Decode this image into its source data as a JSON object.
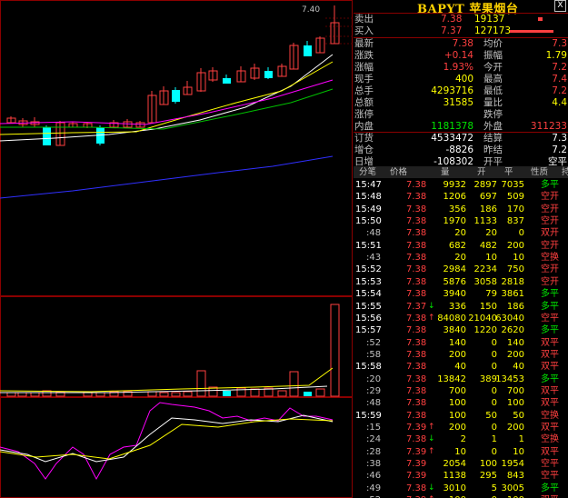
{
  "header": {
    "name": "BAPYT 苹果烟台",
    "close_label": "X"
  },
  "chart": {
    "high_price_label": "7.40"
  },
  "quote": {
    "sell": {
      "label": "卖出",
      "price": "7.38",
      "vol": "19137"
    },
    "buy": {
      "label": "买入",
      "price": "7.37",
      "vol": "127173"
    },
    "rows": [
      {
        "l1": "最新",
        "v1": "7.38",
        "l2": "均价",
        "v2": "7.3"
      },
      {
        "l1": "涨跌",
        "v1": "+0.14",
        "l2": "振幅",
        "v2": "1.79"
      },
      {
        "l1": "涨幅",
        "v1": "1.93%",
        "l2": "今开",
        "v2": "7.2"
      },
      {
        "l1": "现手",
        "v1": "400",
        "l2": "最高",
        "v2": "7.4"
      },
      {
        "l1": "总手",
        "v1": "4293716",
        "l2": "最低",
        "v2": "7.2"
      },
      {
        "l1": "总额",
        "v1": "31585",
        "l2": "量比",
        "v2": "4.4"
      },
      {
        "l1": "涨停",
        "v1": "",
        "l2": "跌停",
        "v2": ""
      },
      {
        "l1": "内盘",
        "v1": "1181378",
        "l2": "外盘",
        "v2": "311233"
      }
    ],
    "rows2": [
      {
        "l1": "订货",
        "v1": "4533472",
        "l2": "结算",
        "v2": "7.3"
      },
      {
        "l1": "增仓",
        "v1": "-8826",
        "l2": "昨结",
        "v2": "7.2"
      },
      {
        "l1": "日增",
        "v1": "-108302",
        "l2": "开平",
        "v2": "空平"
      }
    ]
  },
  "ticks": {
    "headers": [
      "分笔",
      "价格",
      "量",
      "开",
      "平",
      "性质",
      "持"
    ],
    "rows": [
      {
        "t": "15:47",
        "p": "7.38",
        "a": "",
        "q": "9932",
        "o": "2897",
        "c": "7035",
        "n": "多平"
      },
      {
        "t": "15:48",
        "p": "7.38",
        "a": "",
        "q": "1206",
        "o": "697",
        "c": "509",
        "n": "空开"
      },
      {
        "t": "15:49",
        "p": "7.38",
        "a": "",
        "q": "356",
        "o": "186",
        "c": "170",
        "n": "空开"
      },
      {
        "t": "15:50",
        "p": "7.38",
        "a": "",
        "q": "1970",
        "o": "1133",
        "c": "837",
        "n": "空开"
      },
      {
        "t": ":48",
        "p": "7.38",
        "a": "",
        "q": "20",
        "o": "20",
        "c": "0",
        "n": "双开"
      },
      {
        "t": "15:51",
        "p": "7.38",
        "a": "",
        "q": "682",
        "o": "482",
        "c": "200",
        "n": "空开"
      },
      {
        "t": ":43",
        "p": "7.38",
        "a": "",
        "q": "20",
        "o": "10",
        "c": "10",
        "n": "空换"
      },
      {
        "t": "15:52",
        "p": "7.38",
        "a": "",
        "q": "2984",
        "o": "2234",
        "c": "750",
        "n": "空开"
      },
      {
        "t": "15:53",
        "p": "7.38",
        "a": "",
        "q": "5876",
        "o": "3058",
        "c": "2818",
        "n": "空开"
      },
      {
        "t": "15:54",
        "p": "7.38",
        "a": "",
        "q": "3940",
        "o": "79",
        "c": "3861",
        "n": "多平"
      },
      {
        "t": "15:55",
        "p": "7.37",
        "a": "↓",
        "q": "336",
        "o": "150",
        "c": "186",
        "n": "多平"
      },
      {
        "t": "15:56",
        "p": "7.38",
        "a": "↑",
        "q": "84080",
        "o": "21040",
        "c": "63040",
        "n": "空平"
      },
      {
        "t": "15:57",
        "p": "7.38",
        "a": "",
        "q": "3840",
        "o": "1220",
        "c": "2620",
        "n": "多平"
      },
      {
        "t": ":52",
        "p": "7.38",
        "a": "",
        "q": "140",
        "o": "0",
        "c": "140",
        "n": "双平"
      },
      {
        "t": ":58",
        "p": "7.38",
        "a": "",
        "q": "200",
        "o": "0",
        "c": "200",
        "n": "双平"
      },
      {
        "t": "15:58",
        "p": "7.38",
        "a": "",
        "q": "40",
        "o": "0",
        "c": "40",
        "n": "双平"
      },
      {
        "t": ":20",
        "p": "7.38",
        "a": "",
        "q": "13842",
        "o": "389",
        "c": "13453",
        "n": "多平"
      },
      {
        "t": ":29",
        "p": "7.38",
        "a": "",
        "q": "700",
        "o": "0",
        "c": "700",
        "n": "双平"
      },
      {
        "t": ":48",
        "p": "7.38",
        "a": "",
        "q": "100",
        "o": "0",
        "c": "100",
        "n": "双平"
      },
      {
        "t": "15:59",
        "p": "7.38",
        "a": "",
        "q": "100",
        "o": "50",
        "c": "50",
        "n": "空换"
      },
      {
        "t": ":15",
        "p": "7.39",
        "a": "↑",
        "q": "200",
        "o": "0",
        "c": "200",
        "n": "双平"
      },
      {
        "t": ":24",
        "p": "7.38",
        "a": "↓",
        "q": "2",
        "o": "1",
        "c": "1",
        "n": "空换"
      },
      {
        "t": ":28",
        "p": "7.39",
        "a": "↑",
        "q": "10",
        "o": "0",
        "c": "10",
        "n": "双平"
      },
      {
        "t": ":38",
        "p": "7.39",
        "a": "",
        "q": "2054",
        "o": "100",
        "c": "1954",
        "n": "空平"
      },
      {
        "t": ":46",
        "p": "7.39",
        "a": "",
        "q": "1138",
        "o": "295",
        "c": "843",
        "n": "空平"
      },
      {
        "t": ":49",
        "p": "7.38",
        "a": "↓",
        "q": "3010",
        "o": "5",
        "c": "3005",
        "n": "多平"
      },
      {
        "t": ":52",
        "p": "7.39",
        "a": "↑",
        "q": "100",
        "o": "0",
        "c": "100",
        "n": "双平"
      }
    ]
  },
  "colors": {
    "up": "#ff4040",
    "down": "#00ffff",
    "bg": "#000000",
    "grid": "#8b0000"
  }
}
